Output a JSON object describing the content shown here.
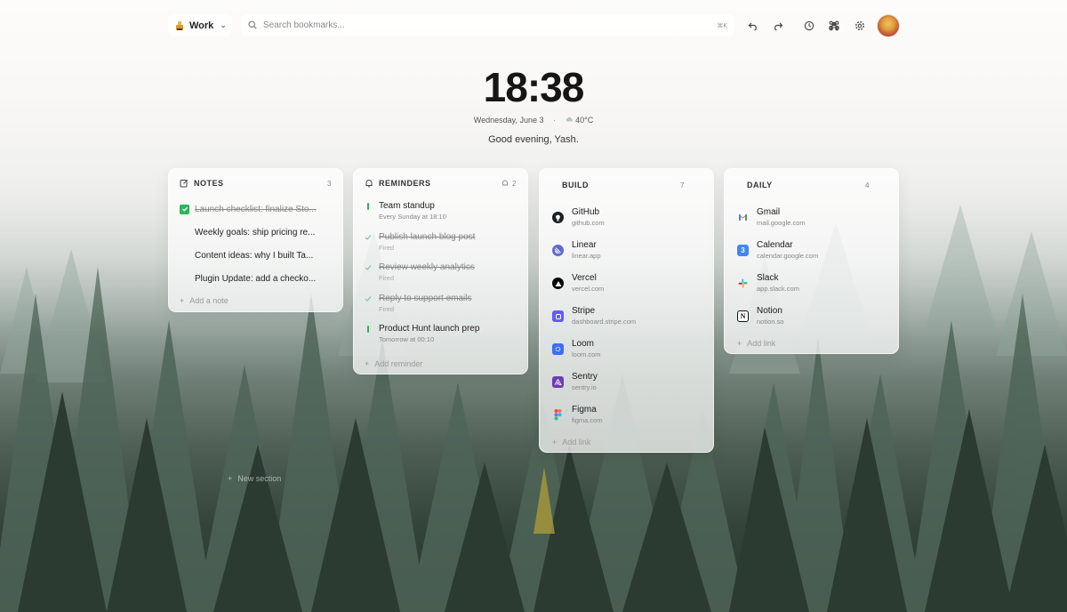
{
  "workspace": {
    "name": "Work"
  },
  "search": {
    "placeholder": "Search bookmarks...",
    "shortcut": "⌘K"
  },
  "clock": {
    "time": "18:38",
    "date": "Wednesday, June 3",
    "weather": "40°C",
    "greeting": "Good evening, Yash."
  },
  "notes": {
    "title": "NOTES",
    "count": "3",
    "items": [
      {
        "text": "Launch checklist: finalize Sto...",
        "done": true
      },
      {
        "text": "Weekly goals: ship pricing re...",
        "done": false
      },
      {
        "text": "Content ideas: why I built Ta...",
        "done": false
      },
      {
        "text": "Plugin Update: add a checko...",
        "done": false
      }
    ],
    "add_label": "Add a note"
  },
  "reminders": {
    "title": "REMINDERS",
    "count": "2",
    "items": [
      {
        "title": "Team standup",
        "sub": "Every Sunday at 18:10",
        "done": false
      },
      {
        "title": "Publish launch blog post",
        "sub": "Fired",
        "done": true
      },
      {
        "title": "Review weekly analytics",
        "sub": "Fired",
        "done": true
      },
      {
        "title": "Reply to support emails",
        "sub": "Fired",
        "done": true
      },
      {
        "title": "Product Hunt launch prep",
        "sub": "Tomorrow at 00:10",
        "done": false
      }
    ],
    "add_label": "Add reminder"
  },
  "build": {
    "title": "BUILD",
    "count": "7",
    "links": [
      {
        "name": "GitHub",
        "url": "github.com",
        "icon": "github-icon",
        "color": "#1b1f23"
      },
      {
        "name": "Linear",
        "url": "linear.app",
        "icon": "linear-icon",
        "color": "#5e6ad2"
      },
      {
        "name": "Vercel",
        "url": "vercel.com",
        "icon": "vercel-icon",
        "color": "#000000"
      },
      {
        "name": "Stripe",
        "url": "dashboard.stripe.com",
        "icon": "stripe-icon",
        "color": "#635bff"
      },
      {
        "name": "Loom",
        "url": "loom.com",
        "icon": "loom-icon",
        "color": "#3b6ef5"
      },
      {
        "name": "Sentry",
        "url": "sentry.io",
        "icon": "sentry-icon",
        "color": "#6c3fb0"
      },
      {
        "name": "Figma",
        "url": "figma.com",
        "icon": "figma-icon",
        "color": "#f24e1e"
      }
    ],
    "add_label": "Add link"
  },
  "daily": {
    "title": "DAILY",
    "count": "4",
    "links": [
      {
        "name": "Gmail",
        "url": "mail.google.com",
        "icon": "gmail-icon",
        "color": "#ea4335"
      },
      {
        "name": "Calendar",
        "url": "calendar.google.com",
        "icon": "calendar-icon",
        "color": "#4285f4",
        "glyph": "3"
      },
      {
        "name": "Slack",
        "url": "app.slack.com",
        "icon": "slack-icon",
        "color": "#4a154b"
      },
      {
        "name": "Notion",
        "url": "notion.so",
        "icon": "notion-icon",
        "color": "#111111",
        "glyph": "N"
      }
    ],
    "add_label": "Add link"
  },
  "new_section": {
    "label": "New section"
  }
}
